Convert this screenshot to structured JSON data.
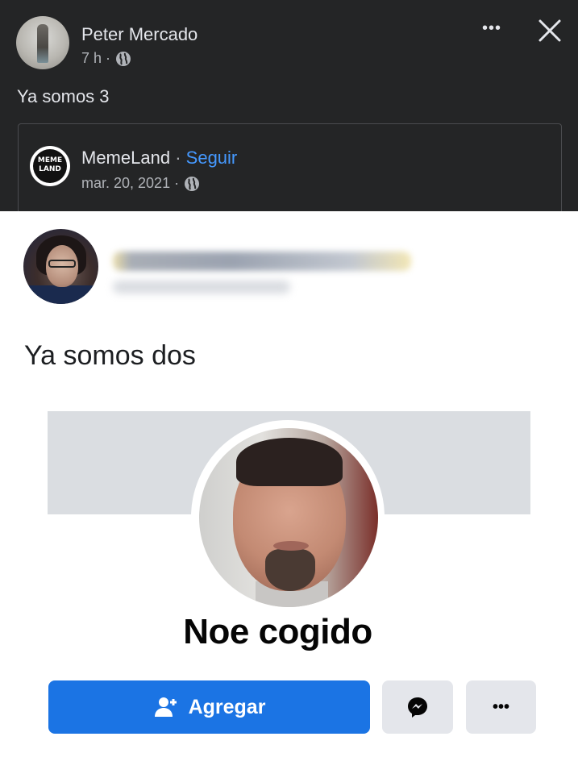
{
  "post": {
    "author_name": "Peter Mercado",
    "time": "7 h ·",
    "caption": "Ya somos 3"
  },
  "shared_page": {
    "logo_text_1": "MEME",
    "logo_text_2": "LAND",
    "name": "MemeLand",
    "separator": "·",
    "follow_label": "Seguir",
    "date": "mar. 20, 2021 ·"
  },
  "meme": {
    "caption": "Ya somos dos",
    "profile_name": "Noe cogido",
    "add_label": "Agregar",
    "more_label": "•••"
  },
  "icons": {
    "more": "more-horizontal-icon",
    "close": "close-icon",
    "globe": "globe-icon",
    "messenger": "messenger-icon",
    "add_user": "add-user-icon"
  },
  "colors": {
    "dark_bg": "#242526",
    "link_blue": "#4599ff",
    "button_blue": "#1b74e4",
    "button_gray": "#e4e6eb"
  }
}
